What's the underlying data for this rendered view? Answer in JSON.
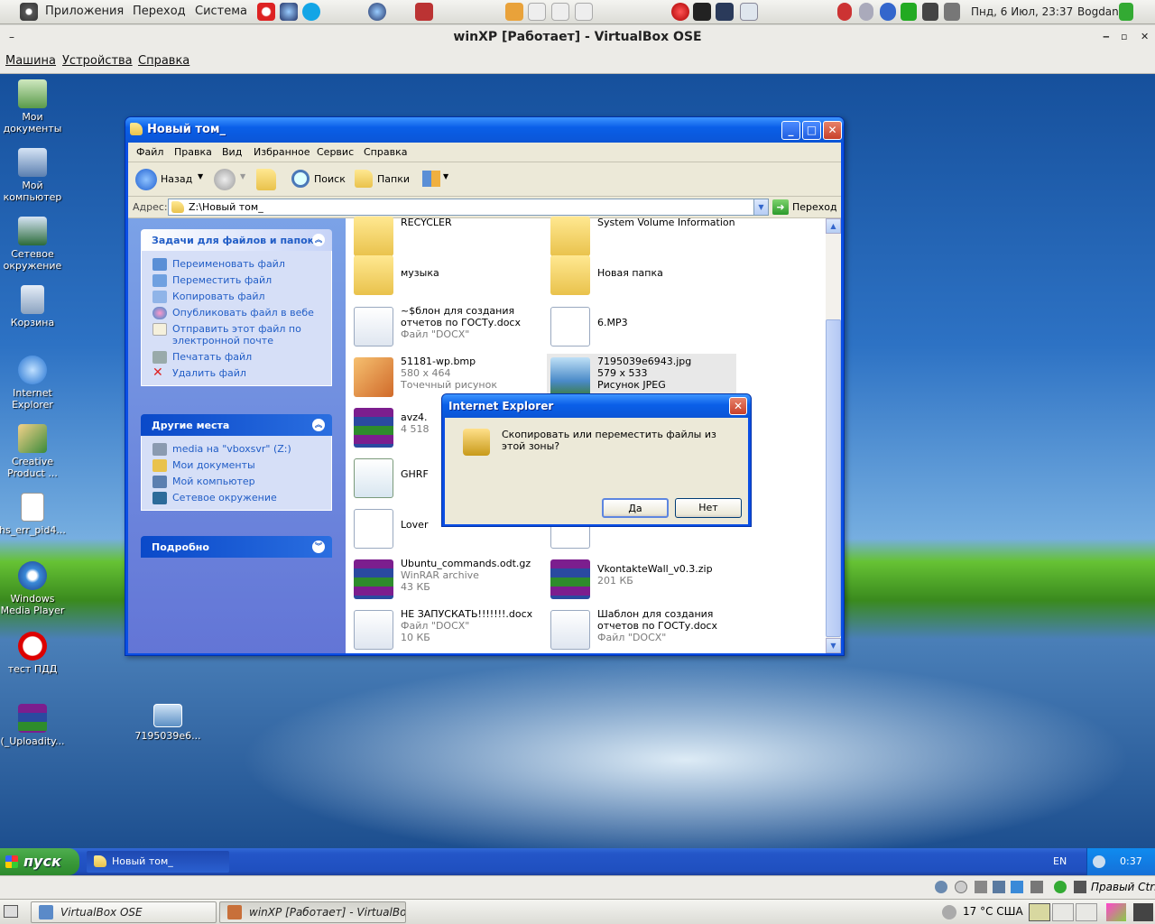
{
  "gnome_top": {
    "menus": [
      "Приложения",
      "Переход",
      "Система"
    ],
    "clock": "Пнд, 6 Июл, 23:37",
    "user": "Bogdan"
  },
  "vbox": {
    "title": "winXP [Работает] - VirtualBox OSE",
    "menu": [
      "Машина",
      "Устройства",
      "Справка"
    ],
    "host_key": "Правый Ctrl"
  },
  "desktop_icons": [
    {
      "label": "Мои документы",
      "icon": "my-documents-icon"
    },
    {
      "label": "Мой компьютер",
      "icon": "my-computer-icon"
    },
    {
      "label": "Сетевое окружение",
      "icon": "network-places-icon"
    },
    {
      "label": "Корзина",
      "icon": "recycle-bin-icon"
    },
    {
      "label": "Internet Explorer",
      "icon": "internet-explorer-icon"
    },
    {
      "label": "Creative Product ...",
      "icon": "creative-product-icon"
    },
    {
      "label": "hs_err_pid4...",
      "icon": "text-file-icon"
    },
    {
      "label": "Windows Media Player",
      "icon": "media-player-icon"
    },
    {
      "label": "тест ПДД",
      "icon": "pdd-test-icon"
    },
    {
      "label": "(_Uploadity...",
      "icon": "winrar-icon"
    },
    {
      "label": "7195039e6...",
      "icon": "image-file-icon"
    }
  ],
  "explorer": {
    "title": "Новый том_",
    "menu": [
      "Файл",
      "Правка",
      "Вид",
      "Избранное",
      "Сервис",
      "Справка"
    ],
    "toolbar": {
      "back": "Назад",
      "search": "Поиск",
      "folders": "Папки"
    },
    "address_label": "Адрес:",
    "address": "Z:\\Новый том_",
    "go": "Переход",
    "tasks": {
      "header": "Задачи для файлов и папок",
      "items": [
        "Переименовать файл",
        "Переместить файл",
        "Копировать файл",
        "Опубликовать файл в вебе",
        "Отправить этот файл по электронной почте",
        "Печатать файл",
        "Удалить файл"
      ]
    },
    "places": {
      "header": "Другие места",
      "items": [
        "media на \"vboxsvr\" (Z:)",
        "Мои документы",
        "Мой компьютер",
        "Сетевое окружение"
      ]
    },
    "details": {
      "header": "Подробно"
    },
    "files": [
      {
        "name": "RECYCLER",
        "l2": "",
        "l3": "",
        "kind": "folder"
      },
      {
        "name": "System Volume Information",
        "l2": "",
        "l3": "",
        "kind": "folder"
      },
      {
        "name": "музыка",
        "l2": "",
        "l3": "",
        "kind": "folder"
      },
      {
        "name": "Новая папка",
        "l2": "",
        "l3": "",
        "kind": "folder"
      },
      {
        "name": "~$блон для создания отчетов по ГОСТу.docx",
        "l2": "Файл \"DOCX\"",
        "l3": "",
        "kind": "docx"
      },
      {
        "name": "6.MP3",
        "l2": "",
        "l3": "",
        "kind": "mp3"
      },
      {
        "name": "51181-wp.bmp",
        "l2": "580 x 464",
        "l3": "Точечный рисунок",
        "kind": "bmp"
      },
      {
        "name": "7195039e6943.jpg",
        "l2": "579 x 533",
        "l3": "Рисунок JPEG",
        "kind": "jpg"
      },
      {
        "name": "avz4.",
        "l2": "4 518",
        "l3": "",
        "kind": "rar"
      },
      {
        "name": "GHRF",
        "l2": "",
        "l3": "",
        "kind": "ghrf"
      },
      {
        "name": "Lover",
        "l2": "",
        "l3": "",
        "kind": "media"
      },
      {
        "name": "",
        "l2": "",
        "l3": "",
        "kind": "mp3"
      },
      {
        "name": "Ubuntu_commands.odt.gz",
        "l2": "WinRAR archive",
        "l3": "43 КБ",
        "kind": "rar"
      },
      {
        "name": "VkontakteWall_v0.3.zip",
        "l2": "201 КБ",
        "l3": "",
        "kind": "rar"
      },
      {
        "name": "НЕ ЗАПУСКАТЬ!!!!!!!.docx",
        "l2": "Файл \"DOCX\"",
        "l3": "10 КБ",
        "kind": "docx"
      },
      {
        "name": "Шаблон для создания отчетов по ГОСТу.docx",
        "l2": "Файл \"DOCX\"",
        "l3": "",
        "kind": "docx"
      }
    ]
  },
  "dialog": {
    "title": "Internet Explorer",
    "message": "Скопировать или переместить файлы из этой зоны?",
    "yes": "Да",
    "no": "Нет"
  },
  "xp_taskbar": {
    "start": "пуск",
    "task": "Новый том_",
    "lang": "EN",
    "clock": "0:37"
  },
  "gnome_bottom": {
    "tasks": [
      "VirtualBox OSE",
      "winXP [Работает] - VirtualBo..."
    ],
    "weather": "17 °C США"
  },
  "colors": {
    "xp_blue": "#0a4ee4",
    "task_pane": "#6375d6",
    "start_green": "#3a9a3a"
  }
}
